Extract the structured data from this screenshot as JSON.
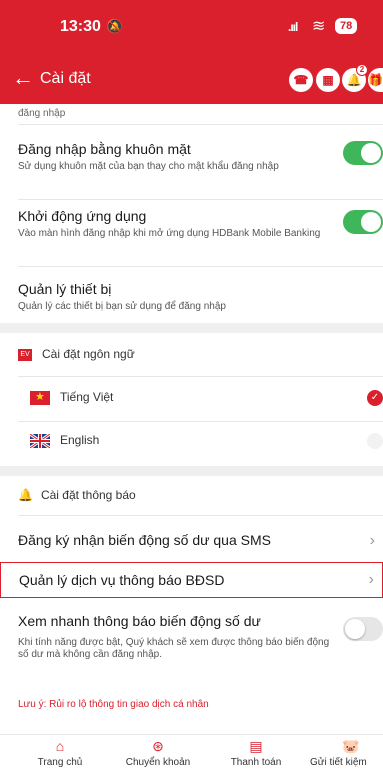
{
  "status_bar": {
    "time": "13:30",
    "battery": "78"
  },
  "header": {
    "title": "Cài đặt",
    "notif_badge": "2"
  },
  "cut_text": "đăng nhập",
  "security": {
    "face_login": {
      "title": "Đăng nhập bằng khuôn mặt",
      "desc": "Sử dụng khuôn mặt của bạn thay cho mật khẩu đăng nhập",
      "enabled": true
    },
    "app_launch": {
      "title": "Khởi động ứng dụng",
      "desc": "Vào màn hình đăng nhập khi mở ứng dụng HDBank Mobile Banking",
      "enabled": true
    },
    "devices": {
      "title": "Quản lý thiết bị",
      "desc": "Quản lý các thiết bị bạn sử dụng để đăng nhập"
    }
  },
  "language": {
    "section_label": "Cài đặt ngôn ngữ",
    "options": [
      {
        "label": "Tiếng Việt",
        "selected": true
      },
      {
        "label": "English",
        "selected": false
      }
    ]
  },
  "notifications": {
    "section_label": "Cài đặt thông báo",
    "sms": "Đăng ký nhận biến động số dư qua SMS",
    "bdsd": "Quản lý dịch vụ thông báo BĐSD",
    "quick_view": {
      "title": "Xem nhanh thông báo biến động số dư",
      "desc": "Khi tính năng được bật, Quý khách sẽ xem được thông báo biến động số dư mà không cần đăng nhập.",
      "enabled": false
    },
    "note": "Lưu ý: Rủi ro lộ thông tin giao dịch cá nhân"
  },
  "tabbar": [
    {
      "label": "Trang chủ",
      "icon": "home-icon"
    },
    {
      "label": "Chuyển khoản",
      "icon": "transfer-icon"
    },
    {
      "label": "Thanh toán",
      "icon": "bill-icon"
    },
    {
      "label": "Gửi tiết kiệm",
      "icon": "piggy-icon"
    }
  ],
  "colors": {
    "brand": "#d9202c",
    "toggle_on": "#3fb65a"
  }
}
